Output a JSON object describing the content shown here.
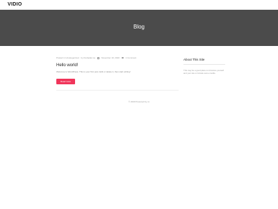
{
  "header": {
    "logo": "VIDIO"
  },
  "hero": {
    "title": "Blog"
  },
  "post": {
    "meta_category": "Posted in Uncategorized",
    "meta_author": "by thehaider.ca",
    "meta_date": "November 19, 2020",
    "meta_comments": "1 Comment",
    "title": "Hello world!",
    "excerpt": "Welcome to WordPress. This is your first post. Edit or delete it, then start writing!",
    "read_more_label": "Read more"
  },
  "sidebar": {
    "title": "About This Site",
    "text": "This may be a good place to introduce yourself and your site or include some credits."
  },
  "footer": {
    "text": "© 2020 Powered by xx"
  },
  "colors": {
    "accent": "#f0355a",
    "hero_bg": "#4b4b4b"
  }
}
